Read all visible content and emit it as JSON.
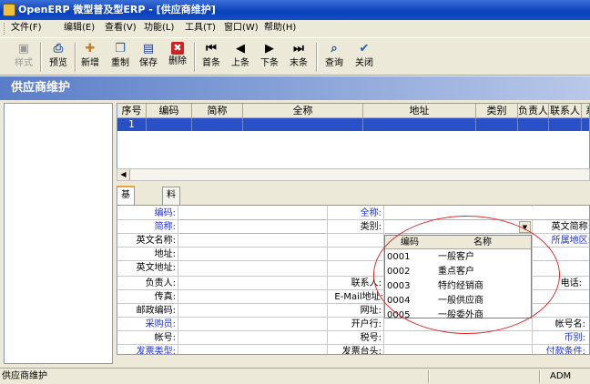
{
  "window": {
    "title": "OpenERP 微型普及型ERP - [供应商维护]"
  },
  "menu": [
    "文件(F)",
    "编辑(E)",
    "查看(V)",
    "功能(L)",
    "工具(T)",
    "窗口(W)",
    "帮助(H)"
  ],
  "toolbar": {
    "style": "样式",
    "preview": "预览",
    "add": "新增",
    "copy": "重制",
    "save": "保存",
    "delete": "删除",
    "first": "首条",
    "prev": "上条",
    "next": "下条",
    "last": "末条",
    "query": "查询",
    "close": "关闭"
  },
  "form_title": "供应商维护",
  "grid": {
    "columns": [
      "序号",
      "编码",
      "简称",
      "全称",
      "地址",
      "类别",
      "负责人",
      "联系人",
      "系"
    ],
    "row1": {
      "seq": "1"
    }
  },
  "tabs": [
    "基本资料",
    "料品最新报价"
  ],
  "fields": {
    "code": "编码:",
    "short": "简称:",
    "full": "全称:",
    "category": "类别:",
    "en_short": "英文简称:",
    "en_name": "英文名称:",
    "region": "所属地区:",
    "address": "地址:",
    "en_address": "英文地址:",
    "owner": "负责人:",
    "contact": "联系人:",
    "phone": "电话:",
    "fax": "传真:",
    "email": "E-Mail地址:",
    "postal": "邮政编码:",
    "website": "网址:",
    "buyer": "采购员:",
    "bank": "开户行:",
    "account_name": "帐号名:",
    "account": "帐号:",
    "tax_no": "税号:",
    "currency": "币别:",
    "invoice_type": "发票类型:",
    "invoice_head": "发票台头:",
    "payment_terms": "付款条件:"
  },
  "dropdown": {
    "col_code": "编码",
    "col_name": "名称",
    "rows": [
      {
        "code": "0001",
        "name": "一般客户"
      },
      {
        "code": "0002",
        "name": "重点客户"
      },
      {
        "code": "0003",
        "name": "特约经销商"
      },
      {
        "code": "0004",
        "name": "一般供应商"
      },
      {
        "code": "0005",
        "name": "一般委外商"
      }
    ]
  },
  "status": {
    "left": "供应商维护",
    "user": "ADM"
  }
}
